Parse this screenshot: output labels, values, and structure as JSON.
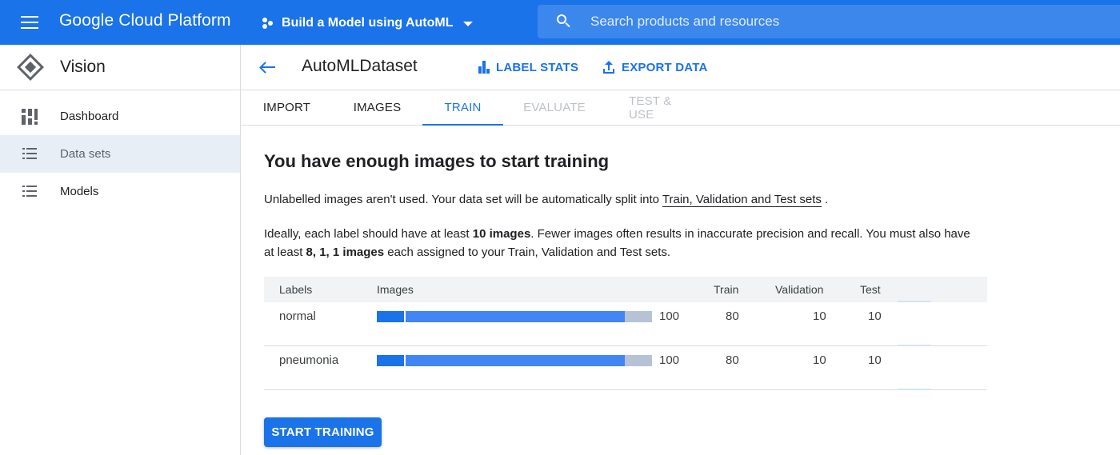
{
  "topbar": {
    "brand": "Google Cloud Platform",
    "project": "Build a Model using AutoML",
    "search_placeholder": "Search products and resources",
    "accent_color": "#1a73e8"
  },
  "sidebar": {
    "title": "Vision",
    "items": [
      {
        "label": "Dashboard",
        "icon": "dashboard-icon"
      },
      {
        "label": "Data sets",
        "icon": "list-icon",
        "active": true
      },
      {
        "label": "Models",
        "icon": "list-icon"
      }
    ]
  },
  "header": {
    "title": "AutoMLDataset",
    "label_stats": "LABEL STATS",
    "export_data": "EXPORT DATA"
  },
  "tabs": [
    {
      "label": "IMPORT",
      "state": "normal"
    },
    {
      "label": "IMAGES",
      "state": "normal"
    },
    {
      "label": "TRAIN",
      "state": "active"
    },
    {
      "label": "EVALUATE",
      "state": "disabled"
    },
    {
      "label": "TEST & USE",
      "state": "disabled"
    }
  ],
  "content": {
    "heading": "You have enough images to start training",
    "para1_prefix": "Unlabelled images aren't used. Your data set will be automatically split into ",
    "para1_link": "Train, Validation and Test sets",
    "para1_suffix": " .",
    "para2_a": "Ideally, each label should have at least ",
    "para2_b": "10 images",
    "para2_c": ". Fewer images often results in inaccurate precision and recall. You must also have",
    "para2_d": "at least ",
    "para2_e": "8, 1, 1 images",
    "para2_f": " each assigned to your Train, Validation and Test sets."
  },
  "table": {
    "columns": [
      "Labels",
      "Images",
      "Train",
      "Validation",
      "Test"
    ],
    "rows": [
      {
        "label": "normal",
        "images": "100",
        "train": "80",
        "validation": "10",
        "test": "10",
        "split": [
          0.1,
          0.8,
          0.1
        ]
      },
      {
        "label": "pneumonia",
        "images": "100",
        "train": "80",
        "validation": "10",
        "test": "10",
        "split": [
          0.1,
          0.8,
          0.1
        ]
      }
    ]
  },
  "actions": {
    "start_training": "START TRAINING"
  }
}
